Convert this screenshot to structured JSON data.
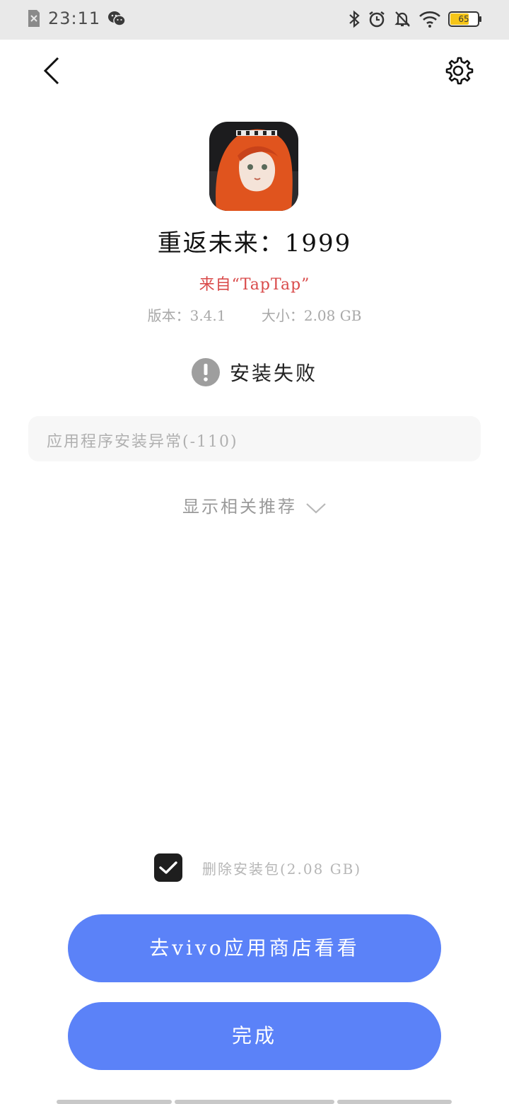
{
  "status_bar": {
    "time": "23:11",
    "battery_level": "65"
  },
  "app": {
    "name": "重返未来：1999",
    "source": "来自“TapTap”",
    "version": "版本：3.4.1",
    "size": "大小：2.08 GB"
  },
  "install": {
    "status": "安装失败",
    "error": "应用程序安装异常(-110)"
  },
  "recommend": {
    "label": "显示相关推荐"
  },
  "options": {
    "delete_package_label": "删除安装包(2.08 GB)",
    "delete_package_checked": true
  },
  "buttons": {
    "store": "去vivo应用商店看看",
    "done": "完成"
  },
  "colors": {
    "primary_button": "#5b82f8",
    "source_text": "#d94a4a"
  }
}
